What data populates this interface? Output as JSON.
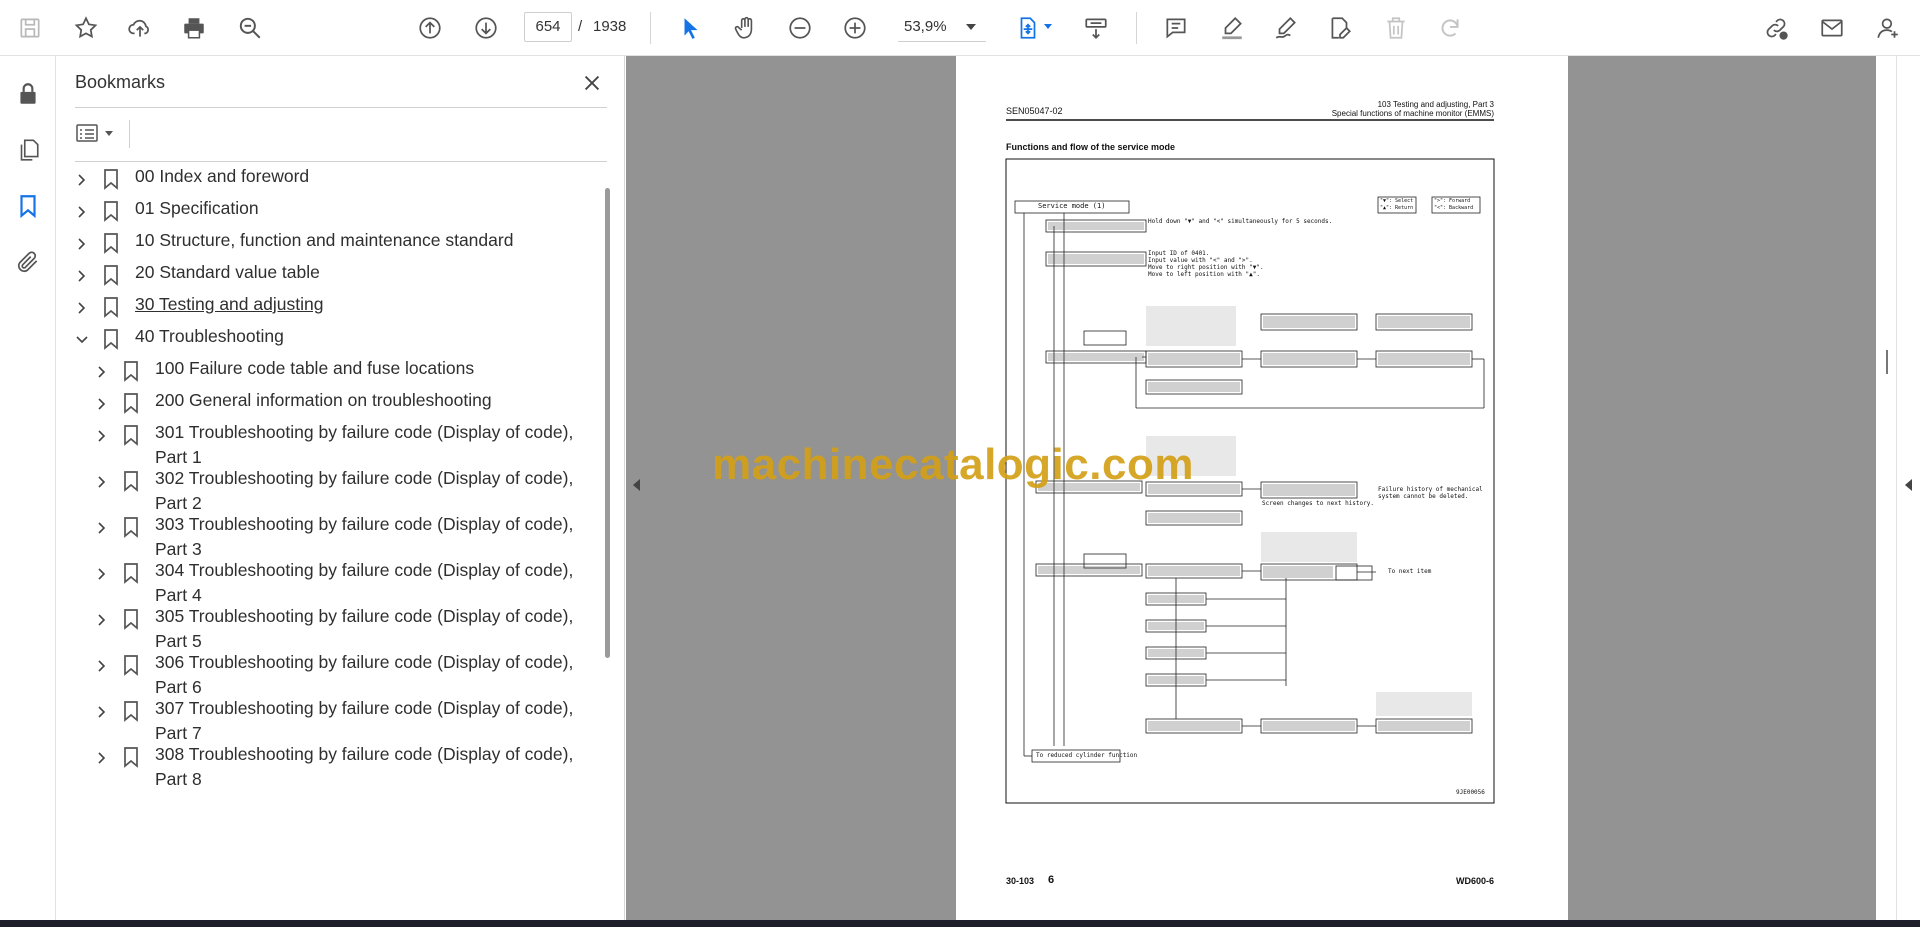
{
  "toolbar": {
    "page_current": "654",
    "page_separator": "/",
    "page_total": "1938",
    "zoom": "53,9%"
  },
  "bookmarks": {
    "title": "Bookmarks",
    "items": [
      {
        "label": "00 Index and foreword",
        "level": 0,
        "expanded": false
      },
      {
        "label": "01 Specification",
        "level": 0,
        "expanded": false
      },
      {
        "label": "10 Structure, function and maintenance standard",
        "level": 0,
        "expanded": false
      },
      {
        "label": "20 Standard value table",
        "level": 0,
        "expanded": false
      },
      {
        "label": "30 Testing and adjusting",
        "level": 0,
        "expanded": false,
        "underlined": true
      },
      {
        "label": "40 Troubleshooting",
        "level": 0,
        "expanded": true
      },
      {
        "label": "100 Failure code table and fuse locations",
        "level": 1,
        "expanded": false
      },
      {
        "label": "200 General information on troubleshooting",
        "level": 1,
        "expanded": false
      },
      {
        "label": "301 Troubleshooting by failure code (Display of code), Part 1",
        "level": 1,
        "expanded": false
      },
      {
        "label": "302 Troubleshooting by failure code (Display of code), Part 2",
        "level": 1,
        "expanded": false
      },
      {
        "label": "303 Troubleshooting by failure code (Display of code), Part 3",
        "level": 1,
        "expanded": false
      },
      {
        "label": "304 Troubleshooting by failure code (Display of code), Part 4",
        "level": 1,
        "expanded": false
      },
      {
        "label": "305 Troubleshooting by failure code (Display of code), Part 5",
        "level": 1,
        "expanded": false
      },
      {
        "label": "306 Troubleshooting by failure code (Display of code), Part 6",
        "level": 1,
        "expanded": false
      },
      {
        "label": "307 Troubleshooting by failure code (Display of code), Part 7",
        "level": 1,
        "expanded": false
      },
      {
        "label": "308 Troubleshooting by failure code (Display of code), Part 8",
        "level": 1,
        "expanded": false
      }
    ]
  },
  "document": {
    "header_left": "SEN05047-02",
    "header_right_1": "103 Testing and adjusting, Part 3",
    "header_right_2": "Special functions of machine monitor (EMMS)",
    "section_title": "Functions and flow of the service mode",
    "diagram_title": "Service mode (1)",
    "diagram_note": "Hold down \"▼\" and \"<\" simultaneously for 5 seconds.",
    "diagram_input_note_1": "Input ID of 0401.",
    "diagram_input_note_2": "Input value with \"<\" and \">\".",
    "diagram_input_note_3": "Move to right position with \"▼\".",
    "diagram_input_note_4": "Move to left position with \"▲\".",
    "legend_1": "\"▼\": Select",
    "legend_2": "\"▲\": Return",
    "legend_3": "\">\": Forward",
    "legend_4": "\"<\": Backward",
    "diagram_note_2": "Failure history of mechanical system cannot be deleted.",
    "diagram_note_3": "Screen changes to next history.",
    "diagram_next": "To next item",
    "diagram_bottom_box": "To reduced cylinder function",
    "diagram_code": "9JE00056",
    "footer_page": "30-103",
    "footer_rev": "6",
    "footer_model": "WD600-6",
    "watermark": "machinecatalogic.com"
  },
  "colors": {
    "accent": "#1473e6",
    "watermark": "#d4a017"
  },
  "icons": [
    "save-icon",
    "star-icon",
    "upload-icon",
    "print-icon",
    "zoom-search-icon",
    "page-up-icon",
    "page-down-icon",
    "select-arrow-icon",
    "hand-icon",
    "zoom-out-icon",
    "zoom-in-icon",
    "fit-page-icon",
    "scroll-mode-icon",
    "comment-icon",
    "highlight-icon",
    "draw-icon",
    "edit-icon",
    "delete-icon",
    "redo-icon",
    "link-icon",
    "mail-icon",
    "account-icon",
    "lock-icon",
    "pages-icon",
    "bookmark-icon",
    "attachment-icon"
  ]
}
